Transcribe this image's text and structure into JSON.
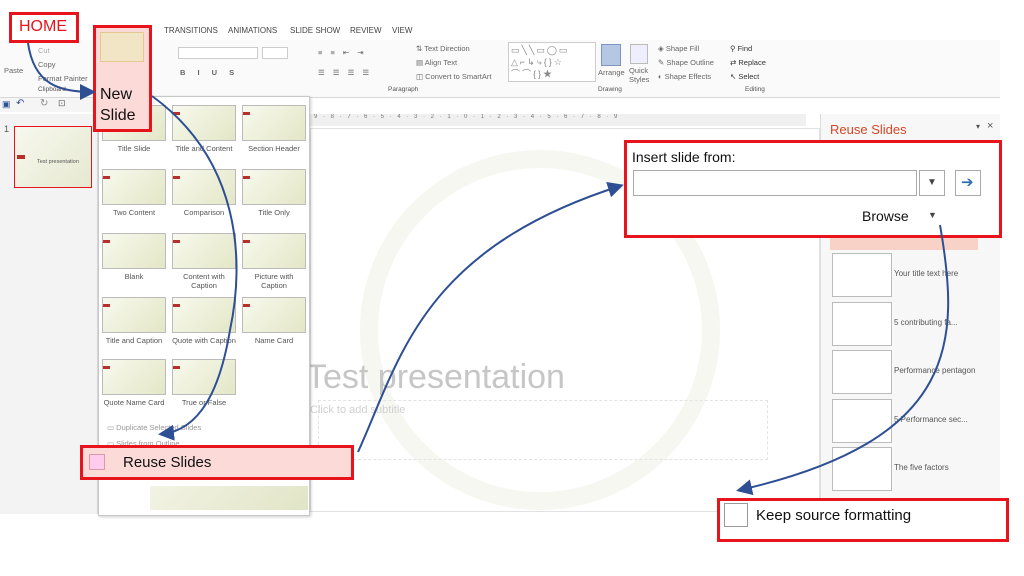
{
  "ribbon": {
    "tabs": [
      "TRANSITIONS",
      "ANIMATIONS",
      "SLIDE SHOW",
      "REVIEW",
      "VIEW"
    ],
    "clipboard": {
      "paste": "Paste",
      "cut": "Cut",
      "copy": "Copy",
      "format_painter": "Format Painter",
      "label": "Clipboard"
    },
    "new_slide_menu_label": "New Slide",
    "paragraph": {
      "text_direction": "Text Direction",
      "align_text": "Align Text",
      "convert": "Convert to SmartArt",
      "label": "Paragraph"
    },
    "drawing": {
      "arrange": "Arrange",
      "quick_styles": "Quick Styles",
      "shape_fill": "Shape Fill",
      "shape_outline": "Shape Outline",
      "shape_effects": "Shape Effects",
      "label": "Drawing"
    },
    "editing": {
      "find": "Find",
      "replace": "Replace",
      "select": "Select",
      "label": "Editing"
    }
  },
  "callouts": {
    "home": "HOME",
    "new_slide": "New Slide",
    "reuse_slides": "Reuse Slides",
    "insert_from": "Insert slide from:",
    "browse": "Browse",
    "keep_source": "Keep source formatting"
  },
  "thumbnails": {
    "slide_number": "1",
    "slide_text": "Test presentation"
  },
  "layouts": [
    {
      "label": "Title Slide"
    },
    {
      "label": "Title and Content"
    },
    {
      "label": "Section Header"
    },
    {
      "label": "Two Content"
    },
    {
      "label": "Comparison"
    },
    {
      "label": "Title Only"
    },
    {
      "label": "Blank"
    },
    {
      "label": "Content with Caption"
    },
    {
      "label": "Picture with Caption"
    },
    {
      "label": "Title and Caption"
    },
    {
      "label": "Quote with Caption"
    },
    {
      "label": "Name Card"
    },
    {
      "label": "Quote Name Card"
    },
    {
      "label": "True or False"
    }
  ],
  "gallery_links": {
    "duplicate": "Duplicate Selected Slides",
    "from_outline": "Slides from Outline"
  },
  "slide": {
    "title": "Test presentation",
    "subtitle": "Click to add subtitle"
  },
  "ruler_text": "9 · 8 · 7 · 6 · 5 · 4 · 3 · 2 · 1 · 0 · 1 · 2 · 3 · 4 · 5 · 6 · 7 · 8 · 9",
  "reuse_pane": {
    "title": "Reuse Slides",
    "items": [
      {
        "label": "Your title text here"
      },
      {
        "label": "5 contributing fa..."
      },
      {
        "label": "Performance pentagon"
      },
      {
        "label": "5 Performance sec..."
      },
      {
        "label": "The five factors"
      }
    ]
  },
  "colors": {
    "callout_red": "#e8141c",
    "arrow_blue": "#2e4f94",
    "accent": "#d24726"
  }
}
